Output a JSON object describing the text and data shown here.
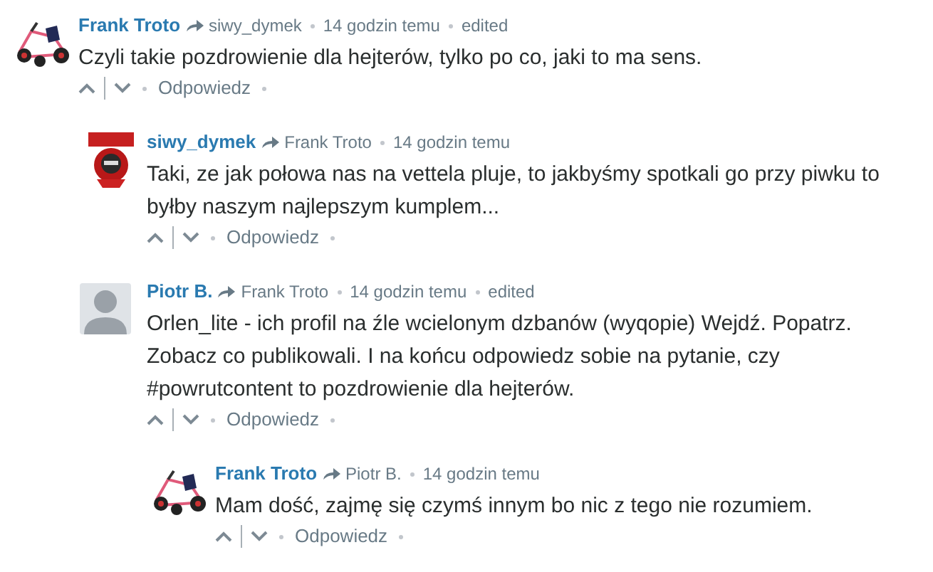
{
  "comments": [
    {
      "author": "Frank Troto",
      "kind": "kart",
      "reply_to": "siwy_dymek",
      "time": "14 godzin temu",
      "edited": "edited",
      "body": "Czyli takie pozdrowienie dla hejterów, tylko po co, jaki to ma sens.",
      "reply": "Odpowiedz",
      "children": [
        {
          "author": "siwy_dymek",
          "kind": "badge",
          "reply_to": "Frank Troto",
          "time": "14 godzin temu",
          "body": "Taki, ze jak połowa nas na vettela pluje, to jakbyśmy spotkali go przy piwku to byłby naszym najlepszym kumplem...",
          "reply": "Odpowiedz"
        },
        {
          "author": "Piotr B.",
          "kind": "default",
          "reply_to": "Frank Troto",
          "time": "14 godzin temu",
          "edited": "edited",
          "body": "Orlen_lite - ich profil na źle wcielonym dzbanów (wyqopie) Wejdź. Popatrz. Zobacz co publikowali. I na końcu odpowiedz sobie na pytanie, czy #powrutcontent to pozdrowienie dla hejterów.",
          "reply": "Odpowiedz",
          "children": [
            {
              "author": "Frank Troto",
              "kind": "kart",
              "reply_to": "Piotr B.",
              "time": "14 godzin temu",
              "body": "Mam dość, zajmę się czymś innym bo nic z tego nie rozumiem.",
              "reply": "Odpowiedz"
            }
          ]
        }
      ]
    }
  ]
}
